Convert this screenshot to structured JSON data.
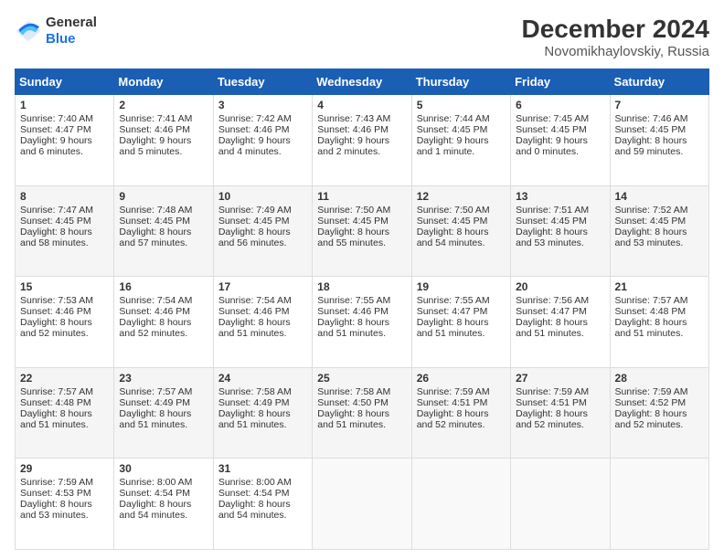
{
  "logo": {
    "line1": "General",
    "line2": "Blue"
  },
  "title": "December 2024",
  "subtitle": "Novomikhaylovskiy, Russia",
  "days": [
    "Sunday",
    "Monday",
    "Tuesday",
    "Wednesday",
    "Thursday",
    "Friday",
    "Saturday"
  ],
  "weeks": [
    [
      {
        "num": "1",
        "sunrise": "Sunrise: 7:40 AM",
        "sunset": "Sunset: 4:47 PM",
        "daylight": "Daylight: 9 hours and 6 minutes."
      },
      {
        "num": "2",
        "sunrise": "Sunrise: 7:41 AM",
        "sunset": "Sunset: 4:46 PM",
        "daylight": "Daylight: 9 hours and 5 minutes."
      },
      {
        "num": "3",
        "sunrise": "Sunrise: 7:42 AM",
        "sunset": "Sunset: 4:46 PM",
        "daylight": "Daylight: 9 hours and 4 minutes."
      },
      {
        "num": "4",
        "sunrise": "Sunrise: 7:43 AM",
        "sunset": "Sunset: 4:46 PM",
        "daylight": "Daylight: 9 hours and 2 minutes."
      },
      {
        "num": "5",
        "sunrise": "Sunrise: 7:44 AM",
        "sunset": "Sunset: 4:45 PM",
        "daylight": "Daylight: 9 hours and 1 minute."
      },
      {
        "num": "6",
        "sunrise": "Sunrise: 7:45 AM",
        "sunset": "Sunset: 4:45 PM",
        "daylight": "Daylight: 9 hours and 0 minutes."
      },
      {
        "num": "7",
        "sunrise": "Sunrise: 7:46 AM",
        "sunset": "Sunset: 4:45 PM",
        "daylight": "Daylight: 8 hours and 59 minutes."
      }
    ],
    [
      {
        "num": "8",
        "sunrise": "Sunrise: 7:47 AM",
        "sunset": "Sunset: 4:45 PM",
        "daylight": "Daylight: 8 hours and 58 minutes."
      },
      {
        "num": "9",
        "sunrise": "Sunrise: 7:48 AM",
        "sunset": "Sunset: 4:45 PM",
        "daylight": "Daylight: 8 hours and 57 minutes."
      },
      {
        "num": "10",
        "sunrise": "Sunrise: 7:49 AM",
        "sunset": "Sunset: 4:45 PM",
        "daylight": "Daylight: 8 hours and 56 minutes."
      },
      {
        "num": "11",
        "sunrise": "Sunrise: 7:50 AM",
        "sunset": "Sunset: 4:45 PM",
        "daylight": "Daylight: 8 hours and 55 minutes."
      },
      {
        "num": "12",
        "sunrise": "Sunrise: 7:50 AM",
        "sunset": "Sunset: 4:45 PM",
        "daylight": "Daylight: 8 hours and 54 minutes."
      },
      {
        "num": "13",
        "sunrise": "Sunrise: 7:51 AM",
        "sunset": "Sunset: 4:45 PM",
        "daylight": "Daylight: 8 hours and 53 minutes."
      },
      {
        "num": "14",
        "sunrise": "Sunrise: 7:52 AM",
        "sunset": "Sunset: 4:45 PM",
        "daylight": "Daylight: 8 hours and 53 minutes."
      }
    ],
    [
      {
        "num": "15",
        "sunrise": "Sunrise: 7:53 AM",
        "sunset": "Sunset: 4:46 PM",
        "daylight": "Daylight: 8 hours and 52 minutes."
      },
      {
        "num": "16",
        "sunrise": "Sunrise: 7:54 AM",
        "sunset": "Sunset: 4:46 PM",
        "daylight": "Daylight: 8 hours and 52 minutes."
      },
      {
        "num": "17",
        "sunrise": "Sunrise: 7:54 AM",
        "sunset": "Sunset: 4:46 PM",
        "daylight": "Daylight: 8 hours and 51 minutes."
      },
      {
        "num": "18",
        "sunrise": "Sunrise: 7:55 AM",
        "sunset": "Sunset: 4:46 PM",
        "daylight": "Daylight: 8 hours and 51 minutes."
      },
      {
        "num": "19",
        "sunrise": "Sunrise: 7:55 AM",
        "sunset": "Sunset: 4:47 PM",
        "daylight": "Daylight: 8 hours and 51 minutes."
      },
      {
        "num": "20",
        "sunrise": "Sunrise: 7:56 AM",
        "sunset": "Sunset: 4:47 PM",
        "daylight": "Daylight: 8 hours and 51 minutes."
      },
      {
        "num": "21",
        "sunrise": "Sunrise: 7:57 AM",
        "sunset": "Sunset: 4:48 PM",
        "daylight": "Daylight: 8 hours and 51 minutes."
      }
    ],
    [
      {
        "num": "22",
        "sunrise": "Sunrise: 7:57 AM",
        "sunset": "Sunset: 4:48 PM",
        "daylight": "Daylight: 8 hours and 51 minutes."
      },
      {
        "num": "23",
        "sunrise": "Sunrise: 7:57 AM",
        "sunset": "Sunset: 4:49 PM",
        "daylight": "Daylight: 8 hours and 51 minutes."
      },
      {
        "num": "24",
        "sunrise": "Sunrise: 7:58 AM",
        "sunset": "Sunset: 4:49 PM",
        "daylight": "Daylight: 8 hours and 51 minutes."
      },
      {
        "num": "25",
        "sunrise": "Sunrise: 7:58 AM",
        "sunset": "Sunset: 4:50 PM",
        "daylight": "Daylight: 8 hours and 51 minutes."
      },
      {
        "num": "26",
        "sunrise": "Sunrise: 7:59 AM",
        "sunset": "Sunset: 4:51 PM",
        "daylight": "Daylight: 8 hours and 52 minutes."
      },
      {
        "num": "27",
        "sunrise": "Sunrise: 7:59 AM",
        "sunset": "Sunset: 4:51 PM",
        "daylight": "Daylight: 8 hours and 52 minutes."
      },
      {
        "num": "28",
        "sunrise": "Sunrise: 7:59 AM",
        "sunset": "Sunset: 4:52 PM",
        "daylight": "Daylight: 8 hours and 52 minutes."
      }
    ],
    [
      {
        "num": "29",
        "sunrise": "Sunrise: 7:59 AM",
        "sunset": "Sunset: 4:53 PM",
        "daylight": "Daylight: 8 hours and 53 minutes."
      },
      {
        "num": "30",
        "sunrise": "Sunrise: 8:00 AM",
        "sunset": "Sunset: 4:54 PM",
        "daylight": "Daylight: 8 hours and 54 minutes."
      },
      {
        "num": "31",
        "sunrise": "Sunrise: 8:00 AM",
        "sunset": "Sunset: 4:54 PM",
        "daylight": "Daylight: 8 hours and 54 minutes."
      },
      null,
      null,
      null,
      null
    ]
  ]
}
